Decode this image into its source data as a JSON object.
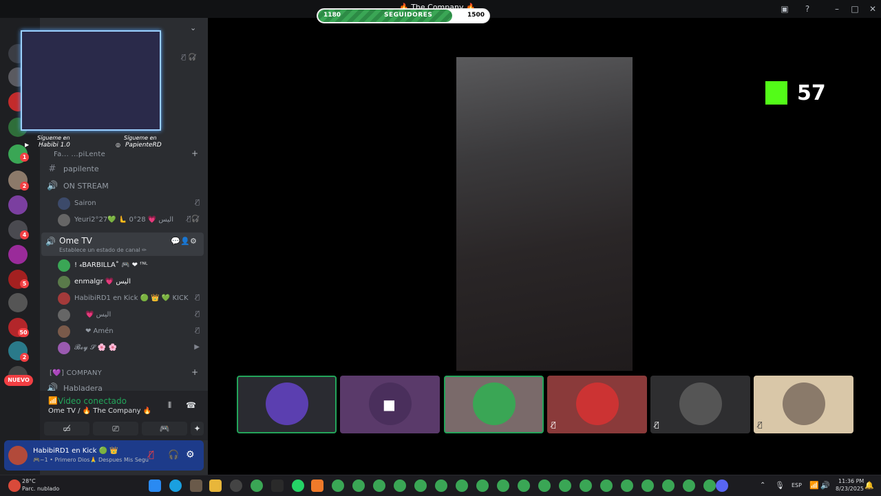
{
  "window": {
    "title": "🔥 The Company 🔥"
  },
  "followers_bar": {
    "min": "1180",
    "label": "SEGUIDORES",
    "max": "1500",
    "current_fraction": 0.787
  },
  "server_rail": {
    "nuevo_label": "NUEVO",
    "badges": [
      "1",
      "2",
      "4",
      "5",
      "50",
      "2"
    ]
  },
  "webcam_overlay": {
    "follow_label_left": "Sígueme en",
    "handle_left": "Habibi 1.0",
    "follow_label_right": "Sígueme en",
    "handle_right": "PapienteRD"
  },
  "channels": {
    "category_partial": "Fa... ...piLente",
    "text_channel": "papilente",
    "voice_onstream": "ON STREAM",
    "onstream_users": [
      "Sairon",
      "Yeuri2°27💚 🫷 0°28 💗 اليس"
    ],
    "ome_tv": {
      "name": "Ome TV",
      "status": "Establece un estado de canal ✏"
    },
    "ome_users": [
      "! ₄BARBILLA˚ 🎮 ❤ ᶠᴺᴸ",
      "enmalgr 💗 اليس",
      "HabibiRD1 en Kick 🟢 👑 💚 KICK",
      "💗 اليس",
      "❤ Amén",
      "𝓑𝓸𝔂 𝓢 🌸 🌸"
    ],
    "category_company": "[💜] COMPANY",
    "habladera": "Habladera"
  },
  "voice_panel": {
    "status": "Video conectado",
    "channel": "Ome TV / 🔥 The Company 🔥"
  },
  "user_panel": {
    "name": "HabibiRD1 en Kick 🟢 👑",
    "status": "🎮~1 • Primero Dios🙏 Despues Mis Segu"
  },
  "kick": {
    "count": "57"
  },
  "taskbar": {
    "weather_temp": "28°C",
    "weather_desc": "Parc. nublado",
    "lang": "ESP",
    "time": "11:36 PM",
    "date": "8/23/2025"
  }
}
